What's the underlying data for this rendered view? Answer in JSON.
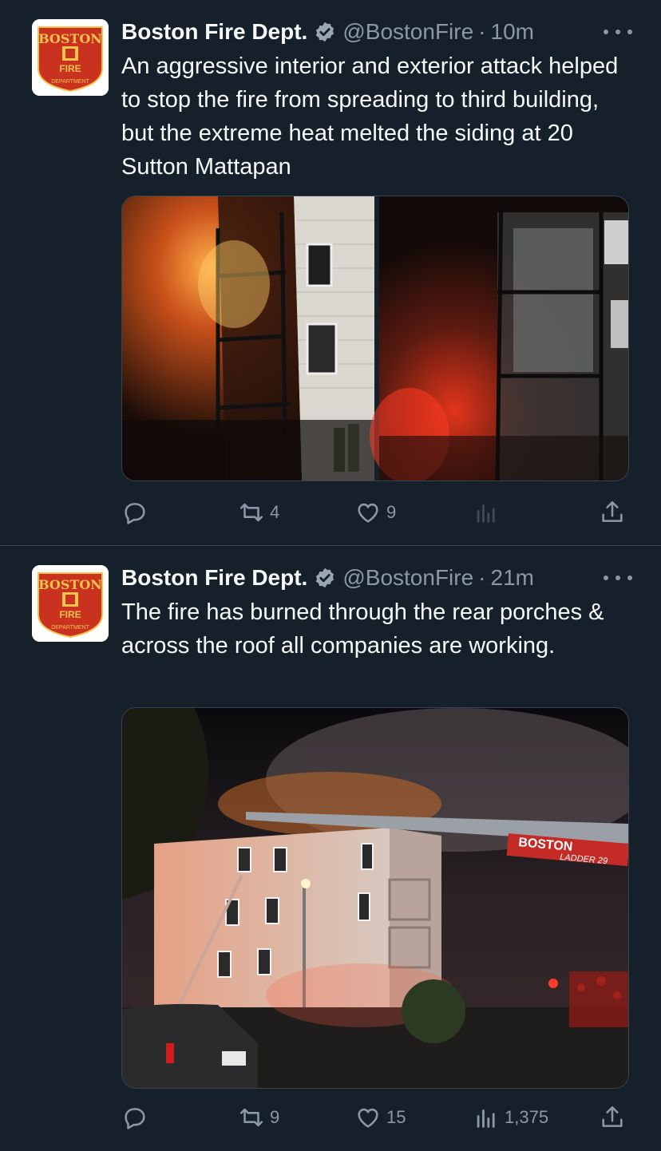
{
  "tweets": [
    {
      "author_name": "Boston Fire Dept.",
      "handle": "@BostonFire",
      "separator": "·",
      "time": "10m",
      "text": "An aggressive interior and exterior attack helped to stop the fire from spreading to third building, but the extreme heat  melted the siding at 20 Sutton Mattapan",
      "replies": "",
      "retweets": "4",
      "likes": "9",
      "views": ""
    },
    {
      "author_name": "Boston Fire Dept.",
      "handle": "@BostonFire",
      "separator": "·",
      "time": "21m",
      "text": "The fire has  burned through the rear porches & across the roof all companies are working.",
      "replies": "",
      "retweets": "9",
      "likes": "15",
      "views": "1,375",
      "photo_text": {
        "ladder_brand": "BOSTON",
        "ladder_unit": "LADDER 29"
      }
    }
  ],
  "avatar": {
    "top_text": "BOSTON",
    "middle_text": "FIRE",
    "bottom_text": "DEPARTMENT"
  },
  "icons": {
    "verified": "verified-badge-icon",
    "more": "more-icon",
    "reply": "reply-icon",
    "retweet": "retweet-icon",
    "like": "like-icon",
    "views": "views-icon",
    "share": "share-icon"
  },
  "colors": {
    "background": "#15202b",
    "text": "#f7f9f9",
    "secondary": "#8b98a5",
    "divider": "#38444d",
    "avatar_red": "#c8321f"
  }
}
